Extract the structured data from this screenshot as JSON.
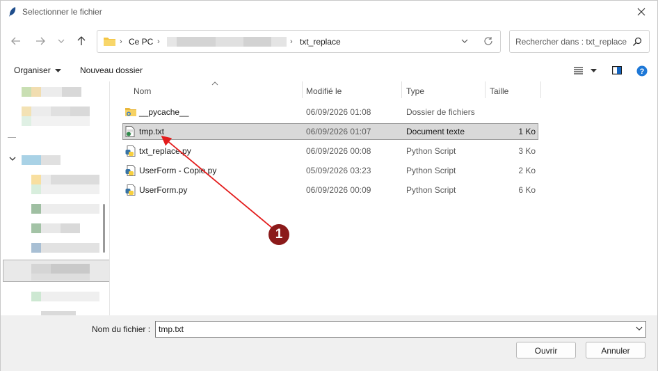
{
  "window": {
    "title": "Selectionner le fichier",
    "app_icon": "feather-icon",
    "close_icon": "close-icon"
  },
  "nav": {
    "back_icon": "arrow-left-icon",
    "forward_icon": "arrow-right-icon",
    "recent_icon": "chevron-down-icon",
    "up_icon": "arrow-up-icon"
  },
  "address": {
    "root": "Ce PC",
    "current": "txt_replace",
    "separator": "›"
  },
  "search": {
    "placeholder": "Rechercher dans : txt_replace"
  },
  "toolbar": {
    "organize": "Organiser",
    "new_folder": "Nouveau dossier"
  },
  "columns": {
    "name": "Nom",
    "modified": "Modifié le",
    "type": "Type",
    "size": "Taille"
  },
  "files": [
    {
      "name": "__pycache__",
      "modified": "06/09/2026 01:08",
      "type": "Dossier de fichiers",
      "size": "",
      "icon": "folder-icon",
      "selected": false
    },
    {
      "name": "tmp.txt",
      "modified": "06/09/2026 01:07",
      "type": "Document texte",
      "size": "1 Ko",
      "icon": "text-file-icon",
      "selected": true
    },
    {
      "name": "txt_replace.py",
      "modified": "06/09/2026 00:08",
      "type": "Python Script",
      "size": "3 Ko",
      "icon": "python-file-icon",
      "selected": false
    },
    {
      "name": "UserForm - Copie.py",
      "modified": "05/09/2026 03:23",
      "type": "Python Script",
      "size": "2 Ko",
      "icon": "python-file-icon",
      "selected": false
    },
    {
      "name": "UserForm.py",
      "modified": "06/09/2026 00:09",
      "type": "Python Script",
      "size": "6 Ko",
      "icon": "python-file-icon",
      "selected": false
    }
  ],
  "bottom": {
    "filename_label": "Nom du fichier :",
    "filename_value": "tmp.txt",
    "open_label": "Ouvrir",
    "cancel_label": "Annuler"
  },
  "annotation": {
    "badge": "1",
    "color": "#e31c1c"
  }
}
